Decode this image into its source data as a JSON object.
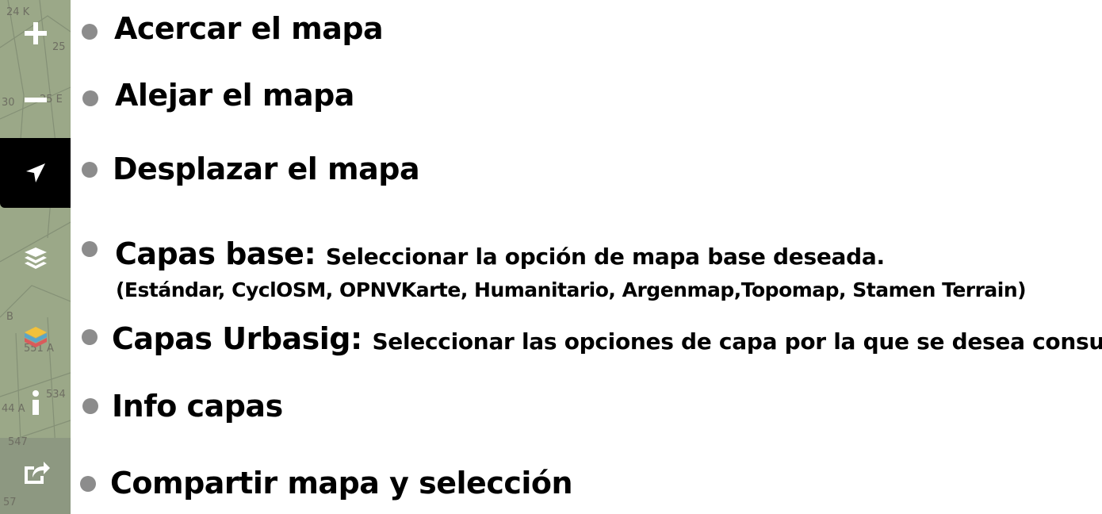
{
  "legend": [
    {
      "id": "zoom_in",
      "label": "Acercar el mapa",
      "icon": "plus-icon"
    },
    {
      "id": "zoom_out",
      "label": "Alejar el mapa",
      "icon": "minus-icon"
    },
    {
      "id": "pan",
      "label": "Desplazar el mapa",
      "icon": "navigation-arrow-icon"
    },
    {
      "id": "base_layers",
      "label": "Capas base:",
      "description": "Seleccionar la opción de mapa base deseada.",
      "options_note": "(Estándar, CyclOSM, OPNVKarte, Humanitario, Argenmap,Topomap, Stamen Terrain)",
      "icon": "layers-icon"
    },
    {
      "id": "urbasig_layers",
      "label": "Capas Urbasig:",
      "description": "Seleccionar las opciones de capa por la que se desea consultar",
      "icon": "colored-layers-icon"
    },
    {
      "id": "info",
      "label": "Info capas",
      "icon": "info-icon"
    },
    {
      "id": "share",
      "label": "Compartir mapa y selección",
      "icon": "share-icon"
    }
  ],
  "map_labels": [
    "24 K",
    "25",
    "30",
    "25 E",
    "B",
    "551 A",
    "534",
    "44 A",
    "547",
    "57"
  ],
  "colors": {
    "map_green": "#a9bb8f",
    "active_button": "#000000",
    "bullet": "#8c8c8c"
  }
}
